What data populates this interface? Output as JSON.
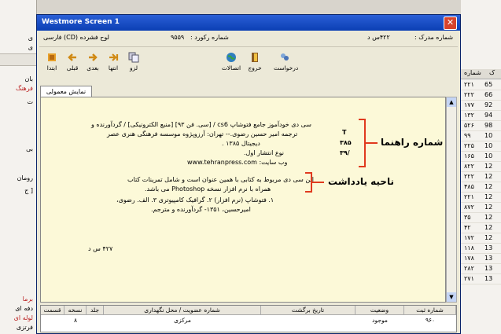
{
  "dialog": {
    "title": "Westmore Screen 1",
    "info": {
      "lcc_label": "لوح فشرده (CD) فارسی",
      "record_label": "شماره رکورد :",
      "record_value": "۹۵۵۹",
      "doc_label": "شماره مدرک :",
      "doc_value": "۴۲۲س د"
    },
    "toolbar": [
      {
        "label": "ابتدا",
        "icon": "first-icon"
      },
      {
        "label": "قبلی",
        "icon": "prev-icon"
      },
      {
        "label": "بعدی",
        "icon": "next-icon"
      },
      {
        "label": "انتها",
        "icon": "last-icon"
      },
      {
        "label": "لزو",
        "icon": "copy-icon"
      },
      {
        "label": "اتصالات",
        "icon": "globe-icon"
      },
      {
        "label": "خروج",
        "icon": "exit-icon"
      },
      {
        "label": "درخواست",
        "icon": "request-icon"
      }
    ],
    "tab_label": "نمایش معمولی",
    "record_lines": [
      "سی دی خودآموز جامع فتوشاپ cs6 / [سی. فن ۹۳] [منبع الکترونیکی] / گردآورنده و",
      "ترجمه امیر حسین رضوی.-- تهران: آرزوپژوه موسسه فرهنگی هنری عصر",
      "دیجیتال ۱۳۸۵ .",
      "نوع انتشار اول.",
      "وب سایت: www.tehranpress.com",
      "این سی دی مربوط به کتابی با همین عنوان است و شامل تمرینات کتاب",
      "همراه با نرم افزار نسخه Photoshop می باشد.",
      "۱. فتوشاپ (نرم افزار) ۲. گرافیک کامپیوتری ۳. الف. رضوی،",
      "امیرحسین، ۱۳۵۱- گردآورنده و مترجم.",
      "۴۲۷ س د"
    ],
    "callnum": [
      "T",
      "۳۸۵",
      "/۳۹"
    ],
    "annotation_callnum": "شماره راهنما",
    "annotation_notes": "ناحیه یادداشت",
    "grid_headers": [
      "شماره ثبت",
      "وضعیت",
      "تاریخ برگشت",
      "شماره عضویت / محل نگهداری",
      "جلد",
      "نسخه",
      "قسمت"
    ],
    "grid_row": [
      "۹۶۰",
      "موجود",
      "",
      "مرکزی",
      "",
      "۸",
      ""
    ]
  },
  "bg_left": [
    "ی",
    "ی",
    "بان",
    "ت",
    "فرهنگ",
    "بی",
    "رومان",
    "[ ج",
    "برما",
    "دفه ای",
    "لوله ای",
    "فرتزی"
  ],
  "bg_right_header": [
    "شماره",
    "ک"
  ],
  "bg_right_rows": [
    [
      "۲۲۱",
      "65"
    ],
    [
      "۲۲۲",
      "66"
    ],
    [
      "۱۷۷",
      "92"
    ],
    [
      "۱۳۲",
      "94"
    ],
    [
      "۵۲۶",
      "98"
    ],
    [
      "۹۹",
      "10"
    ],
    [
      "۲۲۵",
      "10"
    ],
    [
      "۱۶۵",
      "10"
    ],
    [
      "۸۲۲",
      "12"
    ],
    [
      "۲۲۲",
      "12"
    ],
    [
      "۴۸۵",
      "12"
    ],
    [
      "۲۲۱",
      "12"
    ],
    [
      "۸۷۲",
      "12"
    ],
    [
      "۳۵",
      "12"
    ],
    [
      "۴۲",
      "12"
    ],
    [
      "۱۷۲",
      "12"
    ],
    [
      "۱۱۸",
      "13"
    ],
    [
      "۱۷۸",
      "13"
    ],
    [
      "۲۸۲",
      "13"
    ],
    [
      "۲۷۱",
      "13"
    ]
  ],
  "colors": {
    "title_bar": "#0b3fb4",
    "content_bg": "#fcf9d8",
    "annotation_bracket": "#e03a1e"
  }
}
